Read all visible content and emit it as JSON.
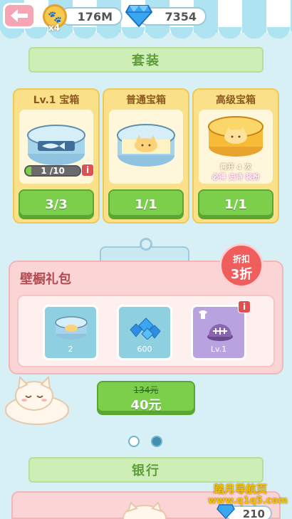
{
  "header": {
    "coins": "176M",
    "coin_multiplier": "x4",
    "gems": "7354"
  },
  "sections": {
    "set_title": "套装",
    "bank_title": "银行"
  },
  "chests": [
    {
      "title": "Lv.1 宝箱",
      "progress_text": "1 /10",
      "progress": 0.1,
      "button_label": "3/3"
    },
    {
      "title": "普通宝箱",
      "button_label": "1/1"
    },
    {
      "title": "高级宝箱",
      "note_line1": "再开 4 次",
      "note_line2": "必得 史诗 装扮",
      "button_label": "1/1"
    }
  ],
  "wall_pack": {
    "title": "壁橱礼包",
    "discount_label": "折扣",
    "discount_value": "3折",
    "items": [
      {
        "label": "2",
        "icon": "cat-can-icon"
      },
      {
        "label": "600",
        "icon": "gem-pile-icon"
      },
      {
        "label": "Lv.1",
        "icon": "fish-bone-dish-icon"
      }
    ],
    "original_price": "134元",
    "price": "40元"
  },
  "pager": {
    "total": 2,
    "active_index": 1
  },
  "bank": {
    "gem_value": "210"
  },
  "watermark": {
    "line1": "踏月导航页",
    "line2": "www.q1q5.com"
  },
  "colors": {
    "accent_green": "#7ccf4a",
    "panel_pink": "#fbd4d5",
    "chest_gold": "#fbe08a",
    "bg_blue": "#d7f0f6"
  }
}
